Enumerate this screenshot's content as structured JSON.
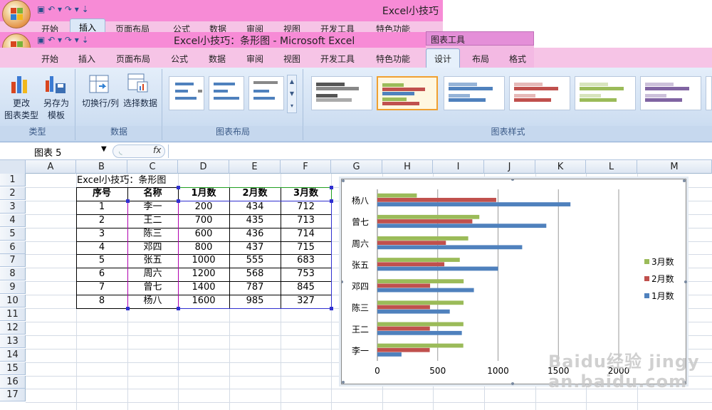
{
  "ghost_window": {
    "title": "Excel小技巧",
    "tabs": [
      "开始",
      "插入",
      "页面布局",
      "公式",
      "数据",
      "审阅",
      "视图",
      "开发工具",
      "特色功能"
    ]
  },
  "window": {
    "title": "Excel小技巧：条形图 - Microsoft Excel",
    "chart_tools_label": "图表工具"
  },
  "ribbon_tabs": [
    "开始",
    "插入",
    "页面布局",
    "公式",
    "数据",
    "审阅",
    "视图",
    "开发工具",
    "特色功能",
    "设计",
    "布局",
    "格式"
  ],
  "active_tab": "设计",
  "ribbon": {
    "groups": {
      "type": "类型",
      "data": "数据",
      "layout": "图表布局",
      "styles": "图表样式"
    },
    "buttons": {
      "change_type_line1": "更改",
      "change_type_line2": "图表类型",
      "save_template_line1": "另存为",
      "save_template_line2": "模板",
      "switch_rowcol": "切换行/列",
      "select_data": "选择数据"
    }
  },
  "formula_bar": {
    "name_box": "图表 5",
    "fx": "fx",
    "value": ""
  },
  "columns": [
    "A",
    "B",
    "C",
    "D",
    "E",
    "F",
    "G",
    "H",
    "I",
    "J",
    "K",
    "L",
    "M"
  ],
  "rows": [
    "1",
    "2",
    "3",
    "4",
    "5",
    "6",
    "7",
    "8",
    "9",
    "10",
    "11",
    "12",
    "13",
    "14",
    "15",
    "16",
    "17"
  ],
  "sheet": {
    "title": "Excel小技巧：条形图",
    "headers": [
      "序号",
      "名称",
      "1月数",
      "2月数",
      "3月数"
    ],
    "data": [
      [
        "1",
        "李一",
        "200",
        "434",
        "712"
      ],
      [
        "2",
        "王二",
        "700",
        "435",
        "713"
      ],
      [
        "3",
        "陈三",
        "600",
        "436",
        "714"
      ],
      [
        "4",
        "邓四",
        "800",
        "437",
        "715"
      ],
      [
        "5",
        "张五",
        "1000",
        "555",
        "683"
      ],
      [
        "6",
        "周六",
        "1200",
        "568",
        "753"
      ],
      [
        "7",
        "曾七",
        "1400",
        "787",
        "845"
      ],
      [
        "8",
        "杨八",
        "1600",
        "985",
        "327"
      ]
    ]
  },
  "chart_data": {
    "type": "bar",
    "orientation": "horizontal",
    "categories": [
      "李一",
      "王二",
      "陈三",
      "邓四",
      "张五",
      "周六",
      "曾七",
      "杨八"
    ],
    "series": [
      {
        "name": "1月数",
        "values": [
          200,
          700,
          600,
          800,
          1000,
          1200,
          1400,
          1600
        ],
        "color": "#4f81bd"
      },
      {
        "name": "2月数",
        "values": [
          434,
          435,
          436,
          437,
          555,
          568,
          787,
          985
        ],
        "color": "#c0504d"
      },
      {
        "name": "3月数",
        "values": [
          712,
          713,
          714,
          715,
          683,
          753,
          845,
          327
        ],
        "color": "#9bbb59"
      }
    ],
    "xlim": [
      0,
      2000
    ],
    "x_ticks": [
      "0",
      "500",
      "1000",
      "1500",
      "2000"
    ],
    "grid": "vertical",
    "legend": "right",
    "legend_order": [
      "3月数",
      "2月数",
      "1月数"
    ]
  },
  "colors": {
    "title_pink": "#f78bd6",
    "tab_pink": "#f6c4e6",
    "ribbon_blue": "#dbe8f7",
    "series1": "#4f81bd",
    "series2": "#c0504d",
    "series3": "#9bbb59",
    "name_border": "#b000b0",
    "value_border": "#3030d0",
    "header_border": "#20a020"
  },
  "watermark": "Baidu经验 jingyan.baidu.com"
}
